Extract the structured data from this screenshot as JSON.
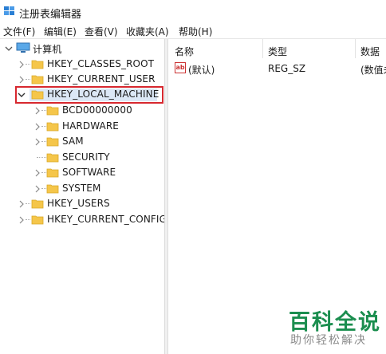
{
  "window": {
    "title": "注册表编辑器"
  },
  "menu": [
    "文件(F)",
    "编辑(E)",
    "查看(V)",
    "收藏夹(A)",
    "帮助(H)"
  ],
  "tree": {
    "root": "计算机",
    "nodes": [
      "HKEY_CLASSES_ROOT",
      "HKEY_CURRENT_USER",
      "HKEY_LOCAL_MACHINE",
      "BCD00000000",
      "HARDWARE",
      "SAM",
      "SECURITY",
      "SOFTWARE",
      "SYSTEM",
      "HKEY_USERS",
      "HKEY_CURRENT_CONFIG"
    ],
    "selected": "HKEY_LOCAL_MACHINE"
  },
  "list": {
    "columns": [
      "名称",
      "类型",
      "数据"
    ],
    "rows": [
      {
        "name": "(默认)",
        "type": "REG_SZ",
        "data": "(数值未"
      }
    ]
  },
  "watermark": {
    "title": "百科全说",
    "subtitle": "助你轻松解决"
  },
  "colors": {
    "highlight": "#d7282f",
    "folder": "#f5c64a",
    "watermark": "#1b8e4f"
  }
}
